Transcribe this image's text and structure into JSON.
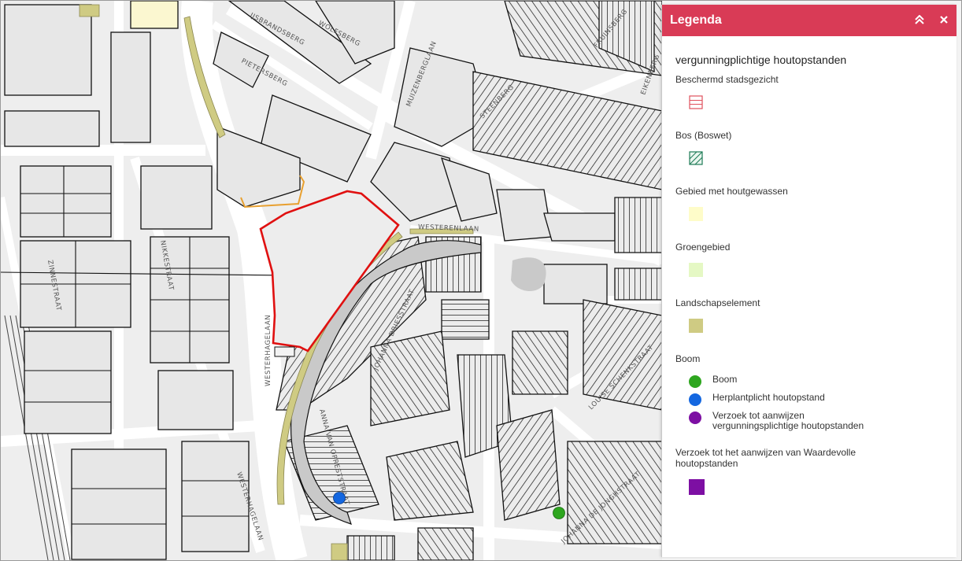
{
  "legend": {
    "title": "Legenda",
    "collapse_icon": "double-chevron-up-icon",
    "close_icon": "close-icon",
    "layer_title": "vergunningplichtige houtopstanden",
    "groups": [
      {
        "label": "Beschermd stadsgezicht",
        "swatch": "red-grid-outline",
        "color": "#e0505c"
      },
      {
        "label": "Bos (Boswet)",
        "swatch": "green-hatch",
        "color": "#1e7b57"
      },
      {
        "label": "Gebied met houtgewassen",
        "swatch": "fill",
        "color": "#fefcc9"
      },
      {
        "label": "Groengebied",
        "swatch": "fill",
        "color": "#e5f8c4"
      },
      {
        "label": "Landschapselement",
        "swatch": "fill",
        "color": "#cfcb83"
      }
    ],
    "boom": {
      "label": "Boom",
      "items": [
        {
          "label": "Boom",
          "color": "#2ea61f"
        },
        {
          "label": "Herplantplicht houtopstand",
          "color": "#1467e0"
        },
        {
          "label": "Verzoek tot aanwijzen vergunningsplichtige houtopstanden",
          "color": "#7d0fa3"
        }
      ]
    },
    "waardevol": {
      "label": "Verzoek tot het aanwijzen van Waardevolle houtopstanden",
      "color": "#7d0fa3"
    }
  },
  "map": {
    "streets": [
      "IJSBRANDSBERG",
      "WOLFSBERG",
      "PIETERSBERG",
      "MUIZENBERGLAAN",
      "STEENBERG",
      "EIKENBERG",
      "FRUINSBERG",
      "WESTERENLAAN",
      "NIKKESTRAAT",
      "ZINNESTRAAT",
      "WESTERHAGELAAN",
      "JOHANNA DRIESSTRAAT",
      "ANNA VAN OPRESTSTRAAT",
      "LOUISE SCHENKSTRAAT",
      "JOHANNA DE JONGHSTRAAT"
    ],
    "colors": {
      "block": "#e9e9e9",
      "road": "#ffffff",
      "line": "#1a1a1a",
      "water": "#c9c9c9",
      "landscape": "#cfcb83",
      "woodland": "#fefcc9",
      "selection": "#e01010",
      "orange": "#e8a030"
    },
    "trees": [
      {
        "type": "Boom",
        "color": "#2ea61f"
      },
      {
        "type": "Herplantplicht houtopstand",
        "color": "#1467e0"
      }
    ]
  }
}
